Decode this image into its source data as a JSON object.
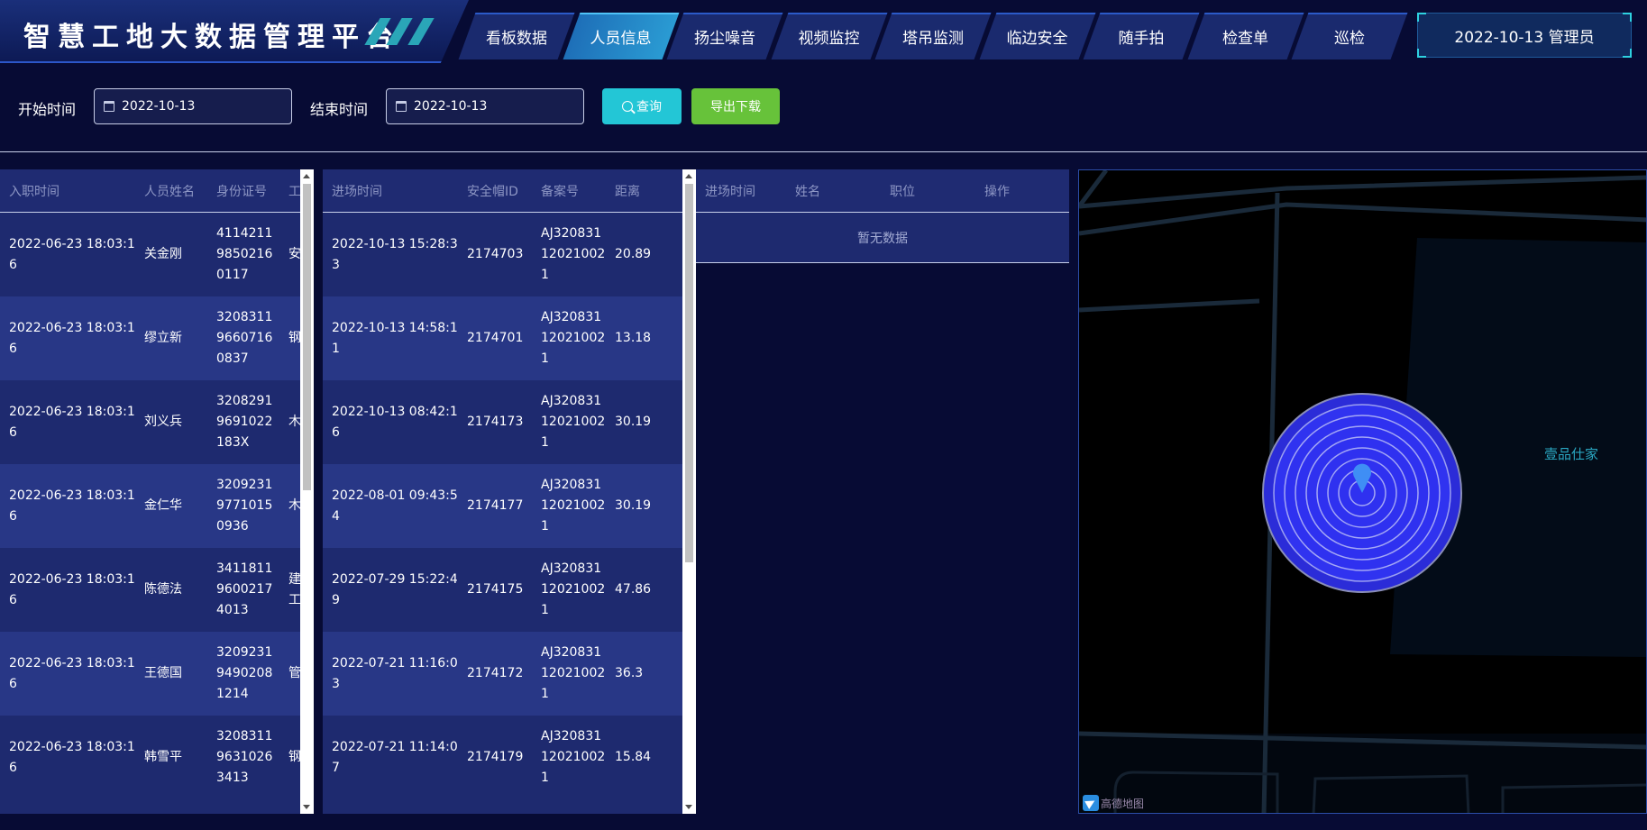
{
  "header": {
    "title": "智慧工地大数据管理平台",
    "nav": [
      {
        "label": "看板数据",
        "active": false
      },
      {
        "label": "人员信息",
        "active": true
      },
      {
        "label": "扬尘噪音",
        "active": false
      },
      {
        "label": "视频监控",
        "active": false
      },
      {
        "label": "塔吊监测",
        "active": false
      },
      {
        "label": "临边安全",
        "active": false
      },
      {
        "label": "随手拍",
        "active": false
      },
      {
        "label": "检查单",
        "active": false
      },
      {
        "label": "巡检",
        "active": false
      }
    ],
    "user_info": "2022-10-13 管理员"
  },
  "filter": {
    "start_label": "开始时间",
    "start_value": "2022-10-13",
    "end_label": "结束时间",
    "end_value": "2022-10-13",
    "query_label": "查询",
    "export_label": "导出下载"
  },
  "staff_table": {
    "columns": [
      "入职时间",
      "人员姓名",
      "身份证号",
      "工"
    ],
    "rows": [
      [
        "2022-06-23 18:03:16",
        "关金刚",
        "411421198502160117",
        "安"
      ],
      [
        "2022-06-23 18:03:16",
        "缪立新",
        "320831196607160837",
        "钢"
      ],
      [
        "2022-06-23 18:03:16",
        "刘义兵",
        "32082919691022183X",
        "木"
      ],
      [
        "2022-06-23 18:03:16",
        "金仁华",
        "320923197710150936",
        "木"
      ],
      [
        "2022-06-23 18:03:16",
        "陈德法",
        "341181196002174013",
        "建工"
      ],
      [
        "2022-06-23 18:03:16",
        "王德国",
        "320923194902081214",
        "管"
      ],
      [
        "2022-06-23 18:03:16",
        "韩雪平",
        "320831196310263413",
        "钢"
      ]
    ]
  },
  "entry_table": {
    "columns": [
      "进场时间",
      "安全帽ID",
      "备案号",
      "距离"
    ],
    "rows": [
      [
        "2022-10-13 15:28:33",
        "2174703",
        "AJ320831120210021",
        "20.89"
      ],
      [
        "2022-10-13 14:58:11",
        "2174701",
        "AJ320831120210021",
        "13.18"
      ],
      [
        "2022-10-13 08:42:16",
        "2174173",
        "AJ320831120210021",
        "30.19"
      ],
      [
        "2022-08-01 09:43:54",
        "2174177",
        "AJ320831120210021",
        "30.19"
      ],
      [
        "2022-07-29 15:22:49",
        "2174175",
        "AJ320831120210021",
        "47.86"
      ],
      [
        "2022-07-21 11:16:03",
        "2174172",
        "AJ320831120210021",
        "36.3"
      ],
      [
        "2022-07-21 11:14:07",
        "2174179",
        "AJ320831120210021",
        "15.84"
      ]
    ]
  },
  "detail_table": {
    "columns": [
      "进场时间",
      "姓名",
      "职位",
      "操作"
    ],
    "empty_text": "暂无数据"
  },
  "map": {
    "place_label": "壹品仕家",
    "attribution": "高德地图"
  }
}
